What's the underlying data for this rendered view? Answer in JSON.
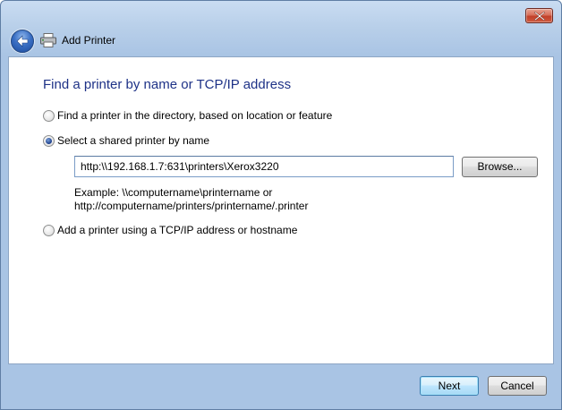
{
  "window": {
    "title": "Add Printer"
  },
  "page": {
    "title": "Find a printer by name or TCP/IP address"
  },
  "options": [
    {
      "label": "Find a printer in the directory, based on location or feature",
      "checked": false
    },
    {
      "label": "Select a shared printer by name",
      "checked": true
    },
    {
      "label": "Add a printer using a TCP/IP address or hostname",
      "checked": false
    }
  ],
  "shared_printer": {
    "value": "http:\\\\192.168.1.7:631\\printers\\Xerox3220",
    "browse_label": "Browse...",
    "example_line1": "Example: \\\\computername\\printername or",
    "example_line2": "http://computername/printers/printername/.printer"
  },
  "footer": {
    "next_label": "Next",
    "cancel_label": "Cancel"
  },
  "colors": {
    "title_text": "#1e3287",
    "chrome": "#a9c4e4",
    "close_button": "#c1402a"
  },
  "icons": {
    "close": "close-icon",
    "back": "back-arrow-icon",
    "printer": "printer-icon"
  }
}
